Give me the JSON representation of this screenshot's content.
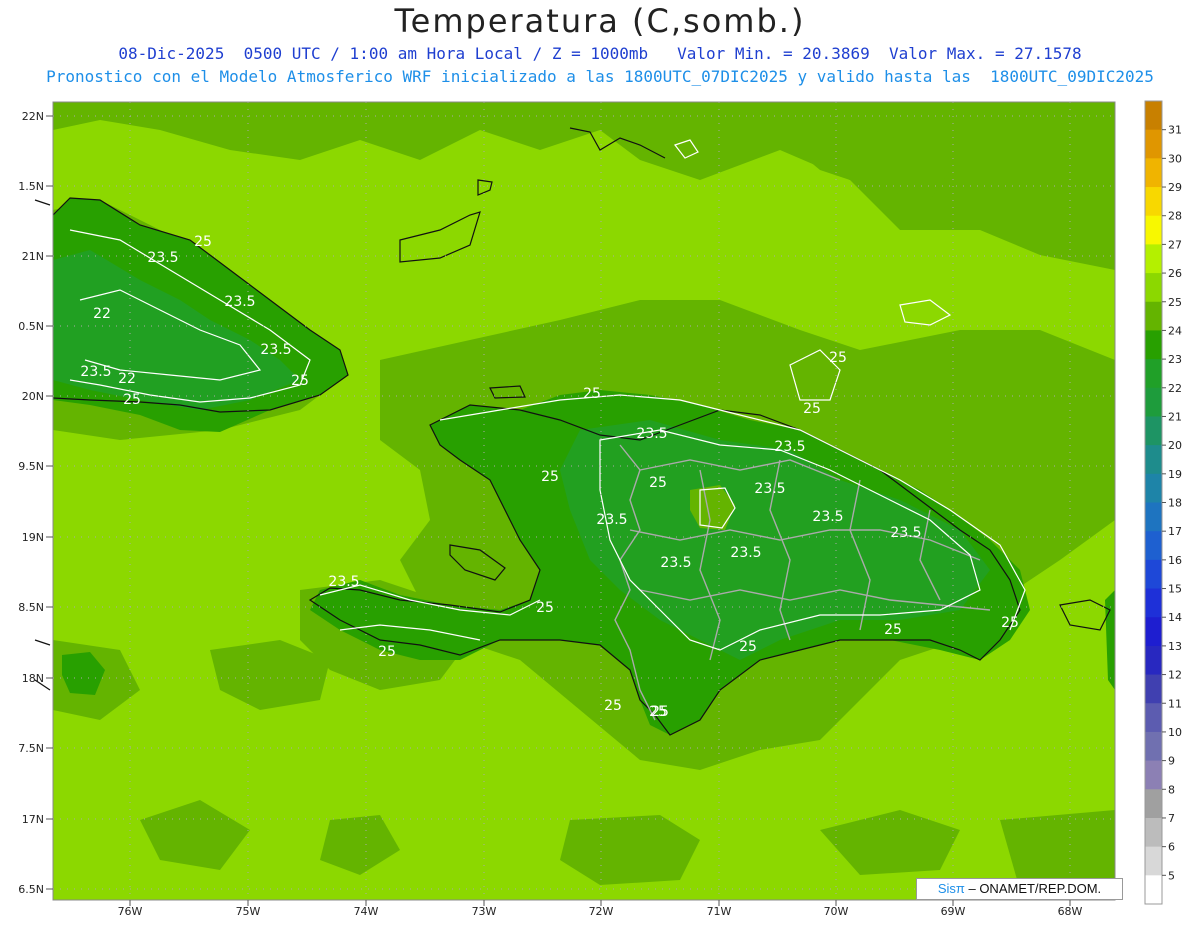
{
  "title": "Temperatura (C,somb.)",
  "subtitle_line1": "08-Dic-2025  0500 UTC / 1:00 am Hora Local / Z = 1000mb   Valor Min. = 20.3869  Valor Max. = 27.1578",
  "subtitle_line2": "Pronostico con el Modelo Atmosferico WRF inicializado a las 1800UTC_07DIC2025 y valido hasta las  1800UTC_09DIC2025",
  "credit": {
    "brand": "Sisπ",
    "org": " – ONAMET/REP.DOM."
  },
  "lat_labels": [
    "22N",
    "1.5N",
    "21N",
    "0.5N",
    "20N",
    "9.5N",
    "19N",
    "8.5N",
    "18N",
    "7.5N",
    "17N",
    "6.5N"
  ],
  "lon_labels": [
    "76W",
    "75W",
    "74W",
    "73W",
    "72W",
    "71W",
    "70W",
    "69W",
    "68W"
  ],
  "colorbar": {
    "labels": [
      "31",
      "30",
      "29",
      "28",
      "27",
      "26",
      "25",
      "24",
      "23",
      "22",
      "21",
      "20",
      "19",
      "18",
      "17",
      "16",
      "15",
      "14",
      "13",
      "12",
      "11",
      "10",
      "9",
      "8",
      "7",
      "6",
      "5"
    ],
    "colors": [
      "#c88000",
      "#e09600",
      "#f0b400",
      "#f8d800",
      "#f8f800",
      "#b4f000",
      "#8cd800",
      "#64b400",
      "#28a000",
      "#20a028",
      "#1e9c3c",
      "#1e9464",
      "#1e8c8c",
      "#1e84a8",
      "#1e74c0",
      "#1e60d0",
      "#1e48d8",
      "#1e30d8",
      "#1e1ed0",
      "#2828c0",
      "#4040b0",
      "#5c5cb0",
      "#7070b0",
      "#8c80b4",
      "#a0a0a0",
      "#bcbcbc",
      "#d8d8d8",
      "#ffffff"
    ]
  },
  "contour_labels": [
    "25",
    "23.5",
    "23.5",
    "22",
    "23.5",
    "23.5",
    "22",
    "25",
    "25",
    "25",
    "25",
    "25",
    "23.5",
    "23.5",
    "25",
    "25",
    "23.5",
    "23.5",
    "23.5",
    "23.5",
    "23.5",
    "23.5",
    "23.5",
    "25",
    "25",
    "25",
    "25",
    "25",
    "25",
    "25",
    "25"
  ],
  "colors": {
    "sea_light": "#8cd800",
    "mid": "#64b400",
    "dark": "#28a000",
    "darker": "#20a028",
    "title_blue": "#1f3fd0",
    "sub_blue": "#1e8fe8"
  }
}
